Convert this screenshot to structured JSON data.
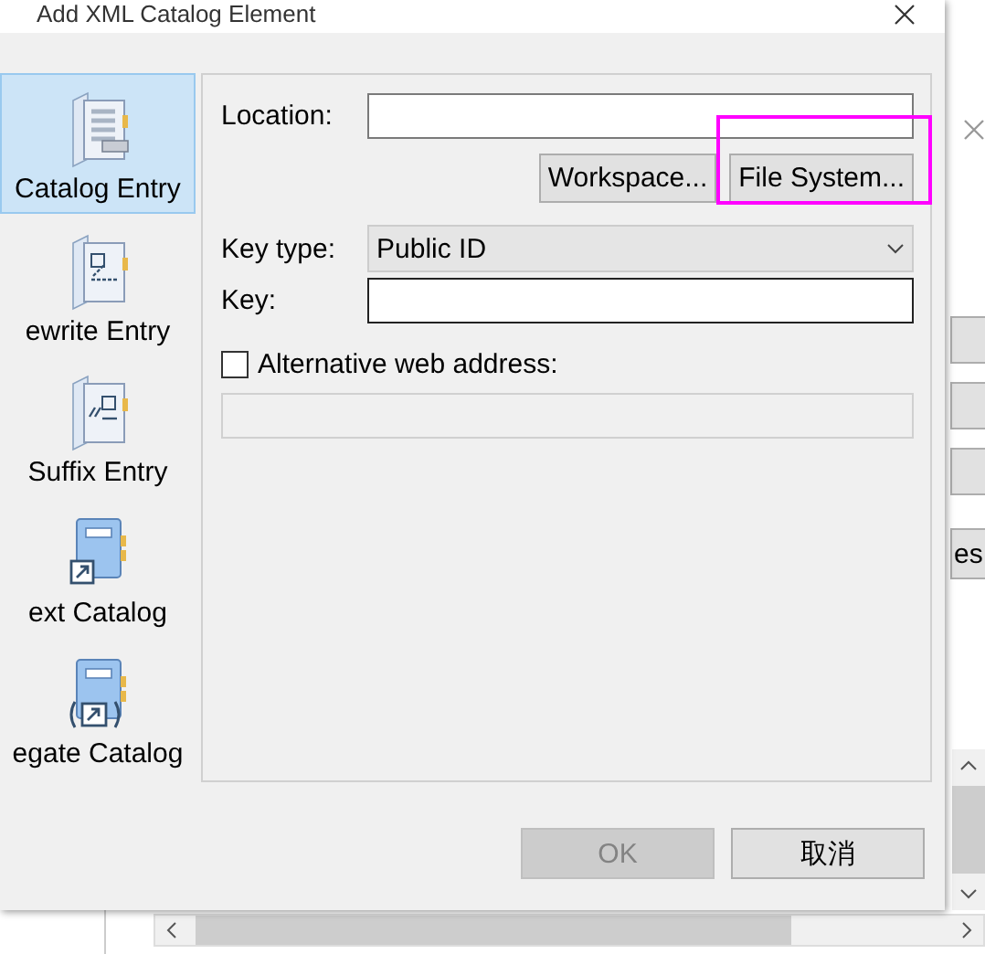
{
  "dialog": {
    "title": "Add XML Catalog Element"
  },
  "sidebar": {
    "items": [
      {
        "label": "Catalog Entry",
        "kind": "catalog",
        "selected": true
      },
      {
        "label": "ewrite Entry",
        "kind": "rewrite",
        "selected": false
      },
      {
        "label": "Suffix Entry",
        "kind": "suffix",
        "selected": false
      },
      {
        "label": "ext Catalog",
        "kind": "next",
        "selected": false
      },
      {
        "label": "egate Catalog",
        "kind": "delegate",
        "selected": false
      }
    ]
  },
  "location": {
    "label": "Location:"
  },
  "browse_buttons": [
    "Workspace...",
    "File System..."
  ],
  "key_type": {
    "label": "Key type:",
    "value": "Public ID"
  },
  "key": {
    "label": "Key:"
  },
  "alternative": {
    "label": "Alternative web address:",
    "checked": false
  },
  "alternative_field": {
    "disabled": true
  },
  "buttons": [
    {
      "label": "OK",
      "disabled": true
    },
    {
      "label": "取消",
      "disabled": false
    }
  ],
  "background_window": {
    "button_text": "es"
  }
}
